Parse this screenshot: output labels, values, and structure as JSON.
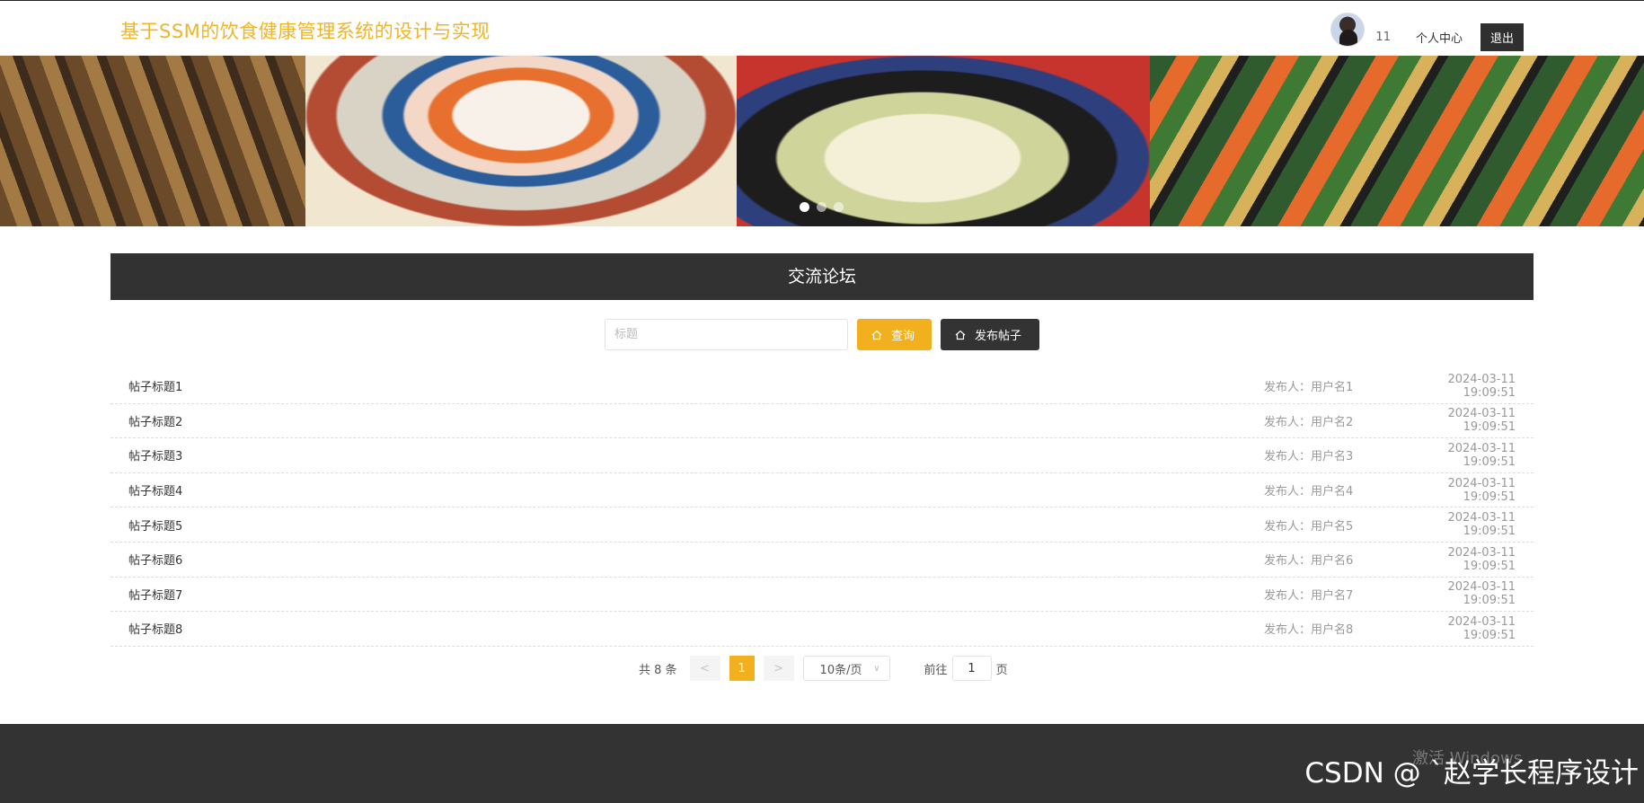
{
  "header": {
    "site_title": "基于SSM的饮食健康管理系统的设计与实现",
    "username": "11",
    "profile_label": "个人中心",
    "logout_label": "退出"
  },
  "banner": {
    "slide_count": 3,
    "active_slide": 1
  },
  "forum": {
    "title": "交流论坛",
    "search_placeholder": "标题",
    "query_label": "查询",
    "post_label": "发布帖子",
    "posts": [
      {
        "title": "帖子标题1",
        "author": "发布人：用户名1",
        "time": "2024-03-11 19:09:51"
      },
      {
        "title": "帖子标题2",
        "author": "发布人：用户名2",
        "time": "2024-03-11 19:09:51"
      },
      {
        "title": "帖子标题3",
        "author": "发布人：用户名3",
        "time": "2024-03-11 19:09:51"
      },
      {
        "title": "帖子标题4",
        "author": "发布人：用户名4",
        "time": "2024-03-11 19:09:51"
      },
      {
        "title": "帖子标题5",
        "author": "发布人：用户名5",
        "time": "2024-03-11 19:09:51"
      },
      {
        "title": "帖子标题6",
        "author": "发布人：用户名6",
        "time": "2024-03-11 19:09:51"
      },
      {
        "title": "帖子标题7",
        "author": "发布人：用户名7",
        "time": "2024-03-11 19:09:51"
      },
      {
        "title": "帖子标题8",
        "author": "发布人：用户名8",
        "time": "2024-03-11 19:09:51"
      }
    ]
  },
  "pagination": {
    "total": "共 8 条",
    "prev": "<",
    "current": "1",
    "next": ">",
    "page_size": "10条/页",
    "goto_prefix": "前往",
    "goto_value": "1",
    "goto_suffix": "页"
  },
  "overlay": {
    "activate_text": "激活 Windows",
    "watermark": "CSDN @ `赵学长程序设计"
  },
  "colors": {
    "accent": "#f2b01e",
    "dark": "#333333",
    "title": "#f0b429"
  }
}
